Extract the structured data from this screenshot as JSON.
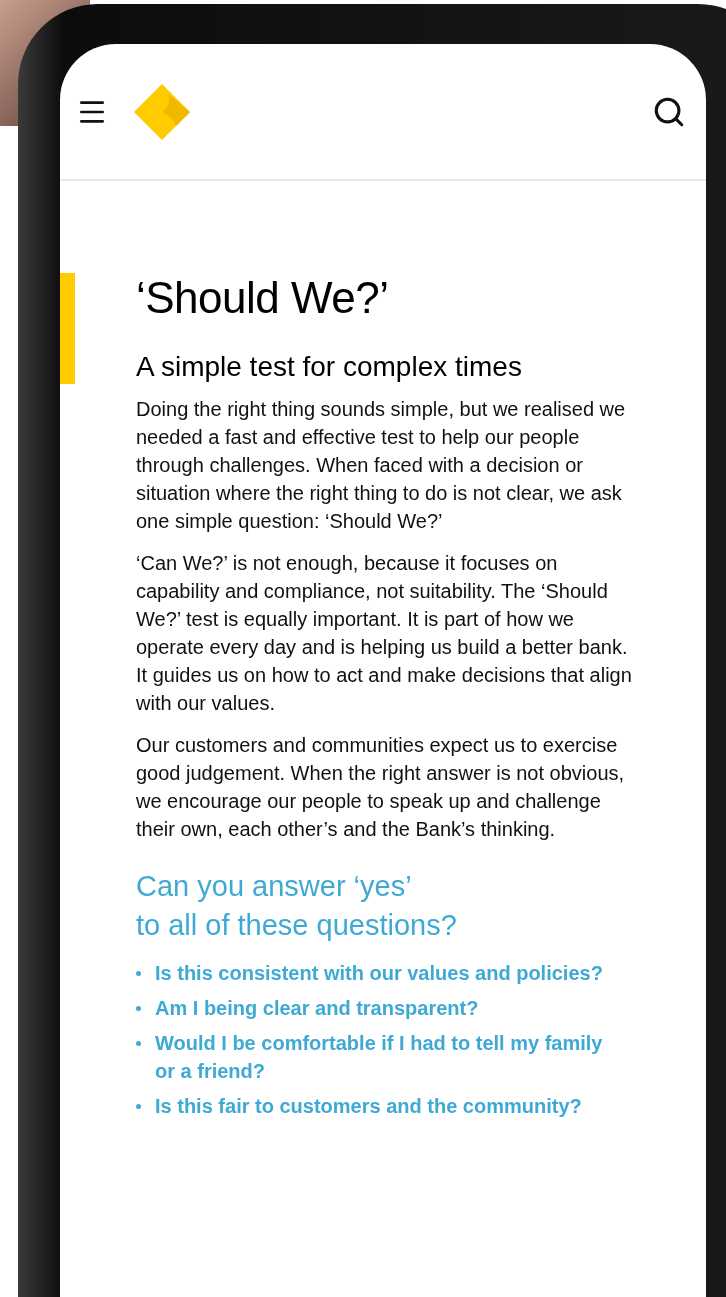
{
  "article": {
    "title": "‘Should We?’",
    "subtitle": "A simple test for complex times",
    "paragraphs": [
      "Doing the right thing sounds simple, but we realised we needed a fast and effective test to help our people through challenges. When faced with a decision or situation where the right thing to do is not clear, we ask one simple question: ‘Should We?’",
      "‘Can We?’ is not enough, because it focuses on capability and compliance, not suitability. The ‘Should We?’ test is equally important. It is part of how we operate every day and is helping us build a better bank. It guides us on how to act and make decisions that align with our values.",
      "Our customers and communities expect us to exercise good judgement. When the right answer is not obvious, we encourage our people to speak up and challenge their own, each other’s and the Bank’s thinking."
    ],
    "question_heading": "Can you answer ‘yes’\nto all of these questions?",
    "questions": [
      "Is this consistent with our values and policies?",
      "Am I being clear and transparent?",
      "Would I be comfortable if I had to tell my family or a friend?",
      "Is this fair to customers and the community?"
    ]
  }
}
